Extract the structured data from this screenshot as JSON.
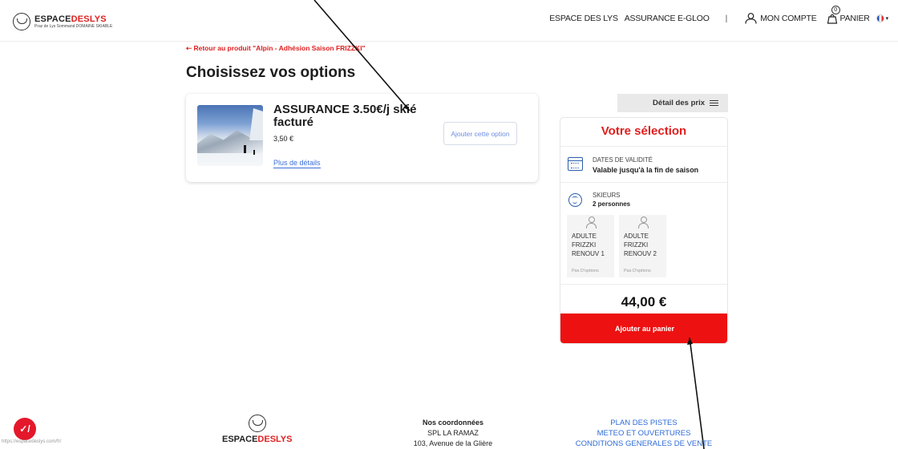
{
  "header": {
    "logo_title_a": "ESPACE",
    "logo_title_b": "DESLYS",
    "logo_sub": "Praz de Lys Sommand  DOMAINE SKIABLE",
    "nav": [
      "ESPACE DES LYS",
      "ASSURANCE E-GLOO"
    ],
    "separator": "|",
    "account": "MON COMPTE",
    "cart": "PANIER",
    "cart_count": "0",
    "flag_caret": "▾"
  },
  "back_link": "⇠ Retour au produit \"Alpin - Adhésion Saison FRIZZKI\"",
  "page_title": "Choisissez vos options",
  "option": {
    "title": "ASSURANCE 3.50€/j skié facturé",
    "price": "3,50 €",
    "details_link": "Plus de détails",
    "add_button": "Ajouter cette option"
  },
  "price_detail_label": "Détail des prix",
  "selection": {
    "title": "Votre sélection",
    "validity_label": "DATES DE VALIDITÉ",
    "validity_value": "Valable jusqu'à la fin de saison",
    "skiers_label": "SKIEURS",
    "skiers_value": "2 personnes",
    "skiers": [
      {
        "name": "ADULTE\nFRIZZKI\nRENOUV 1",
        "options": "Pas D'options"
      },
      {
        "name": "ADULTE\nFRIZZKI\nRENOUV 2",
        "options": "Pas D'options"
      }
    ],
    "total": "44,00 €",
    "add_to_cart": "Ajouter au panier"
  },
  "footer": {
    "brand_a": "ESPACE",
    "brand_b": "DESLYS",
    "contact_heading": "Nos coordonnées",
    "contact_lines": [
      "SPL LA RAMAZ",
      "103, Avenue de la Glière"
    ],
    "links": [
      "PLAN DES PISTES",
      "METEO ET OUVERTURES",
      "CONDITIONS GENERALES DE VENTE"
    ]
  },
  "status_url": "https://espacedeslys.com/fr/",
  "chat_icon": "✓/",
  "colors": {
    "brand_red": "#e01e1e",
    "button_red": "#ee1111",
    "link_blue": "#3b6fd8",
    "icon_blue": "#2b5fad"
  }
}
